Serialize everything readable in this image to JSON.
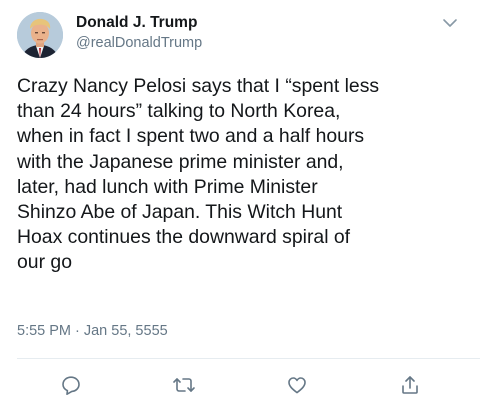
{
  "author": {
    "name": "Donald J. Trump",
    "handle": "@realDonaldTrump"
  },
  "tweet": {
    "lines": [
      "Crazy Nancy Pelosi says that I “spent less",
      "than 24 hours” talking to North Korea,",
      "when in fact I spent two and a half hours",
      "with the Japanese prime minister and,",
      "later, had lunch with Prime Minister",
      "Shinzo Abe of Japan. This Witch Hunt",
      "Hoax continues the downward spiral of",
      "our go"
    ],
    "time": "5:55 PM",
    "separator": "·",
    "date": "Jan 55, 5555"
  },
  "icons": {
    "menu": "chevron-down-icon",
    "reply": "reply-icon",
    "retweet": "retweet-icon",
    "like": "heart-icon",
    "share": "share-icon"
  },
  "colors": {
    "text": "#14171a",
    "secondary": "#657786",
    "icon": "#657786",
    "divider": "#e6ecf0"
  }
}
